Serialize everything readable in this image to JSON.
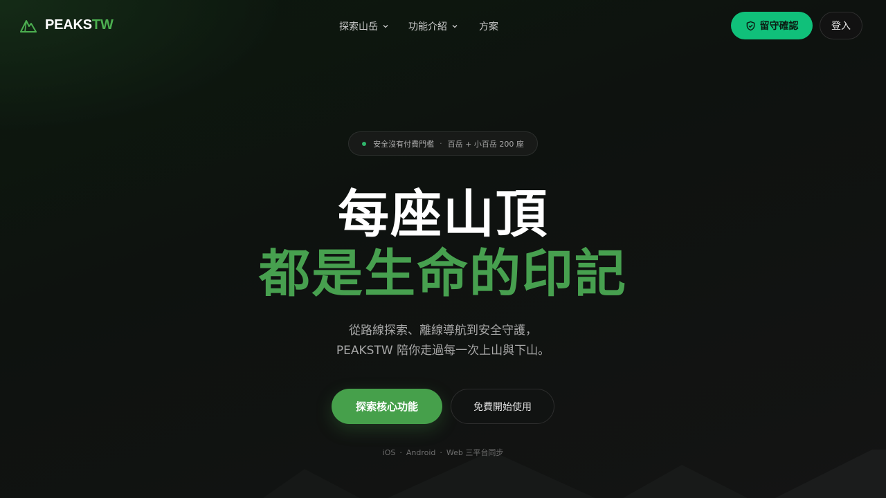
{
  "header": {
    "logo_main": "PEAKS",
    "logo_accent": "TW",
    "nav": [
      {
        "label": "探索山岳",
        "has_dropdown": true
      },
      {
        "label": "功能介紹",
        "has_dropdown": true
      },
      {
        "label": "方案",
        "has_dropdown": false
      }
    ],
    "safety_button": "留守確認",
    "login_button": "登入"
  },
  "hero": {
    "badge_text": "安全沒有付費門檻",
    "badge_sep": "·",
    "badge_detail": "百岳 + 小百岳 200 座",
    "headline_line1": "每座山頂",
    "headline_line2": "都是生命的印記",
    "subtitle_line1": "從路線探索、離線導航到安全守護，",
    "subtitle_line2": "PEAKSTW 陪你走過每一次上山與下山。",
    "cta_primary": "探索核心功能",
    "cta_secondary": "免費開始使用",
    "platforms": [
      "iOS",
      "Android",
      "Web 三平台同步"
    ],
    "platform_sep": "·"
  },
  "colors": {
    "brand_green": "#4caf50",
    "safety_green": "#10c07a",
    "headline_green": "#47a04f",
    "background": "#0d0f0e"
  },
  "icons": {
    "logo": "mountain-icon",
    "dropdown": "chevron-down-icon",
    "safety": "shield-check-icon"
  }
}
